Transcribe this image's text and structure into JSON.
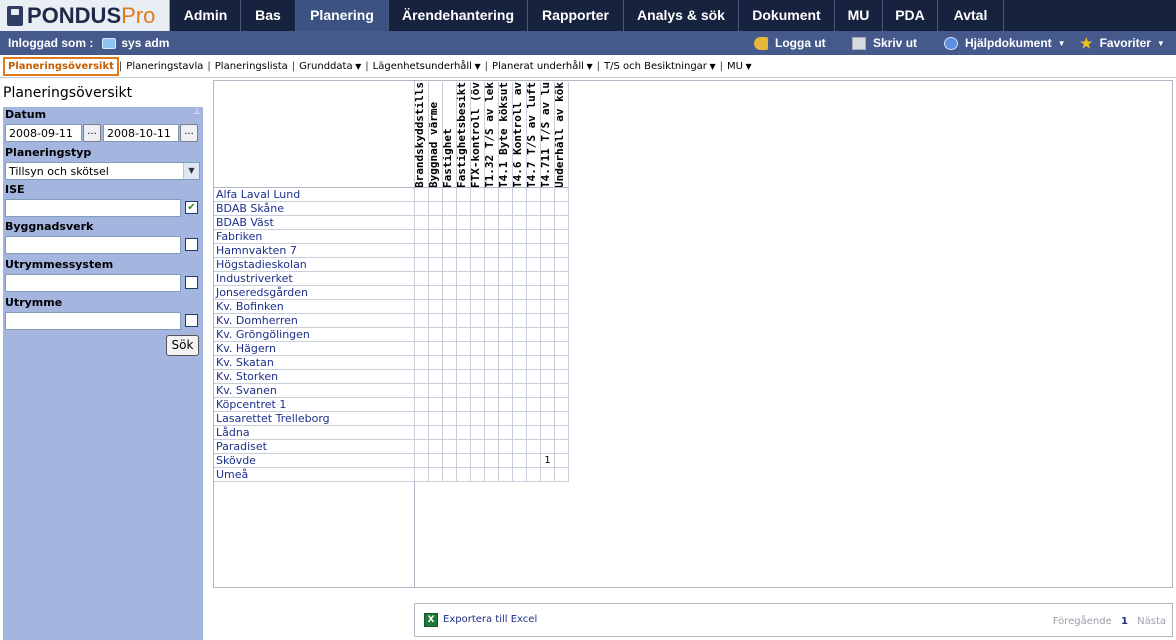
{
  "app": {
    "logo_main": "PONDUS",
    "logo_pro": "Pro"
  },
  "main_nav": [
    {
      "label": "Admin",
      "active": false
    },
    {
      "label": "Bas",
      "active": false
    },
    {
      "label": "Planering",
      "active": true
    },
    {
      "label": "Ärendehantering",
      "active": false
    },
    {
      "label": "Rapporter",
      "active": false
    },
    {
      "label": "Analys & sök",
      "active": false
    },
    {
      "label": "Dokument",
      "active": false
    },
    {
      "label": "MU",
      "active": false
    },
    {
      "label": "PDA",
      "active": false
    },
    {
      "label": "Avtal",
      "active": false
    }
  ],
  "login": {
    "label": "Inloggad som :",
    "user": "sys adm",
    "logout": "Logga ut",
    "print": "Skriv ut",
    "help": "Hjälpdokument",
    "favorites": "Favoriter"
  },
  "sub_nav": [
    {
      "label": "Planeringsöversikt",
      "active": true,
      "dropdown": false
    },
    {
      "label": "Planeringstavla",
      "active": false,
      "dropdown": false
    },
    {
      "label": "Planeringslista",
      "active": false,
      "dropdown": false
    },
    {
      "label": "Grunddata",
      "active": false,
      "dropdown": true
    },
    {
      "label": "Lägenhetsunderhåll",
      "active": false,
      "dropdown": true
    },
    {
      "label": "Planerat underhåll",
      "active": false,
      "dropdown": true
    },
    {
      "label": "T/S och Besiktningar",
      "active": false,
      "dropdown": true
    },
    {
      "label": "MU",
      "active": false,
      "dropdown": true
    }
  ],
  "panel": {
    "title": "Planeringsöversikt",
    "datum_label": "Datum",
    "date_from": "2008-09-11",
    "date_to": "2008-10-11",
    "date_button": "...",
    "planeringstyp_label": "Planeringstyp",
    "planeringstyp_value": "Tillsyn och skötsel",
    "ise_label": "ISE",
    "ise_checked": true,
    "byggnadsverk_label": "Byggnadsverk",
    "utrymmessystem_label": "Utrymmessystem",
    "utrymme_label": "Utrymme",
    "search_button": "Sök"
  },
  "columns": [
    "Brandskyddstills",
    "Byggnad värme",
    "Fastighet",
    "Fastighetsbesikt",
    "FTX-kontroll (öv",
    "T1.32 T/S av lek",
    "T4.1 Byte köksut",
    "T4.6 Kontroll av",
    "T4.7 T/S av luftb",
    "T4.711 T/S av lu",
    "Underhåll av kök"
  ],
  "rows": [
    {
      "name": "Alfa Laval Lund",
      "cells": {}
    },
    {
      "name": "BDAB Skåne",
      "cells": {}
    },
    {
      "name": "BDAB Väst",
      "cells": {}
    },
    {
      "name": "Fabriken",
      "cells": {}
    },
    {
      "name": "Hamnvakten 7",
      "cells": {}
    },
    {
      "name": "Högstadieskolan",
      "cells": {}
    },
    {
      "name": "Industriverket",
      "cells": {}
    },
    {
      "name": "Jonseredsgården",
      "cells": {}
    },
    {
      "name": "Kv. Bofinken",
      "cells": {}
    },
    {
      "name": "Kv. Domherren",
      "cells": {}
    },
    {
      "name": "Kv. Gröngölingen",
      "cells": {}
    },
    {
      "name": "Kv. Hägern",
      "cells": {}
    },
    {
      "name": "Kv. Skatan",
      "cells": {}
    },
    {
      "name": "Kv. Storken",
      "cells": {}
    },
    {
      "name": "Kv. Svanen",
      "cells": {}
    },
    {
      "name": "Köpcentret 1",
      "cells": {}
    },
    {
      "name": "Lasarettet Trelleborg",
      "cells": {}
    },
    {
      "name": "Lådna",
      "cells": {}
    },
    {
      "name": "Paradiset",
      "cells": {}
    },
    {
      "name": "Skövde",
      "cells": {
        "9": "1"
      }
    },
    {
      "name": "Umeå",
      "cells": {}
    }
  ],
  "footer": {
    "export_label": "Exportera till Excel",
    "prev": "Föregående",
    "page": "1",
    "next": "Nästa"
  },
  "colors": {
    "topbar": "#16223e",
    "active_tab": "#3c5282",
    "loginbar": "#45598a",
    "panel": "#a4b5df",
    "accent": "#e07b1a",
    "link": "#1d2f8a"
  }
}
